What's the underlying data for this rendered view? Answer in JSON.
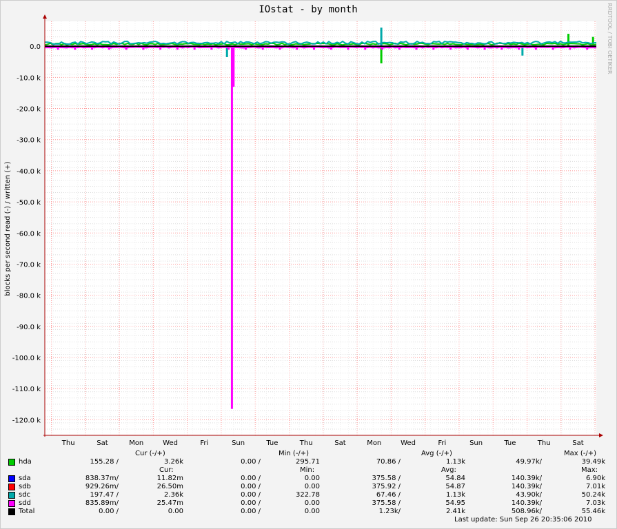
{
  "chart_data": {
    "type": "line",
    "title": "IOstat - by month",
    "ylabel": "blocks per second read (-) / written (+)",
    "watermark": "RRDTOOL / TOBI OETIKER",
    "ylim": [
      -125000,
      8000
    ],
    "yticks": [
      0,
      -10000,
      -20000,
      -30000,
      -40000,
      -50000,
      -60000,
      -70000,
      -80000,
      -90000,
      -100000,
      -110000,
      -120000
    ],
    "ytick_labels": [
      "0.0",
      "-10.0 k",
      "-20.0 k",
      "-30.0 k",
      "-40.0 k",
      "-50.0 k",
      "-60.0 k",
      "-70.0 k",
      "-80.0 k",
      "-90.0 k",
      "-100.0 k",
      "-110.0 k",
      "-120.0 k"
    ],
    "xtick_labels": [
      "Thu",
      "Sat",
      "Mon",
      "Wed",
      "Fri",
      "Sun",
      "Tue",
      "Thu",
      "Sat",
      "Mon",
      "Wed",
      "Fri",
      "Sun",
      "Tue",
      "Thu",
      "Sat"
    ],
    "grid": true,
    "colors": {
      "hda": "#00cc00",
      "sda": "#0000ff",
      "sdb": "#ff0000",
      "sdc": "#00aaaa",
      "sdd": "#ff00ff",
      "total": "#000000",
      "gridline": "#ff9999",
      "axis": "#aa0000",
      "background": "#ffffff",
      "canvas": "#f3f3f3"
    },
    "series": [
      {
        "name": "hda",
        "written_baseline": 700,
        "read_baseline": -70,
        "spikes": [
          {
            "day": 31.9,
            "value": 4000
          },
          {
            "day": 33.4,
            "value": 3000
          },
          {
            "day": 20.5,
            "value": -5500
          }
        ]
      },
      {
        "name": "sdc",
        "written_baseline": 1130,
        "read_baseline": -67,
        "spikes": [
          {
            "day": 20.5,
            "value": 6000
          },
          {
            "day": 29.1,
            "value": -3000
          },
          {
            "day": 11.1,
            "value": -3500
          }
        ]
      },
      {
        "name": "sdd",
        "written_baseline": 55,
        "read_baseline": -376,
        "spikes": [
          {
            "day": 11.4,
            "value": -116500
          },
          {
            "day": 11.5,
            "value": -13000
          }
        ]
      },
      {
        "name": "Total",
        "written_baseline": 0,
        "read_baseline": 0
      }
    ],
    "days_span": 33.6
  },
  "legend": {
    "col_headers": {
      "cur": "Cur (-/+)",
      "min": "Min (-/+)",
      "avg": "Avg (-/+)",
      "max": "Max (-/+)"
    },
    "sub_headers": {
      "cur": "Cur:",
      "min": "Min:",
      "avg": "Avg:",
      "max": "Max:"
    },
    "rows": [
      {
        "name": "hda",
        "color": "#00cc00",
        "cur_r": "155.28 /",
        "cur_w": "3.26k",
        "min_r": "0.00 /",
        "min_w": "295.71",
        "avg_r": "70.86 /",
        "avg_w": "1.13k",
        "max_r": "49.97k/",
        "max_w": "39.49k"
      },
      {
        "name": "sda",
        "color": "#0000ff",
        "cur_r": "838.37m/",
        "cur_w": "11.82m",
        "min_r": "0.00 /",
        "min_w": "0.00",
        "avg_r": "375.58 /",
        "avg_w": "54.84",
        "max_r": "140.39k/",
        "max_w": "6.90k"
      },
      {
        "name": "sdb",
        "color": "#ff0000",
        "cur_r": "929.26m/",
        "cur_w": "26.50m",
        "min_r": "0.00 /",
        "min_w": "0.00",
        "avg_r": "375.92 /",
        "avg_w": "54.87",
        "max_r": "140.39k/",
        "max_w": "7.01k"
      },
      {
        "name": "sdc",
        "color": "#00aaaa",
        "cur_r": "197.47 /",
        "cur_w": "2.36k",
        "min_r": "0.00 /",
        "min_w": "322.78",
        "avg_r": "67.46 /",
        "avg_w": "1.13k",
        "max_r": "43.90k/",
        "max_w": "50.24k"
      },
      {
        "name": "sdd",
        "color": "#ff00ff",
        "cur_r": "835.89m/",
        "cur_w": "25.47m",
        "min_r": "0.00 /",
        "min_w": "0.00",
        "avg_r": "375.58 /",
        "avg_w": "54.95",
        "max_r": "140.39k/",
        "max_w": "7.03k"
      },
      {
        "name": "Total",
        "color": "#000000",
        "cur_r": "0.00 /",
        "cur_w": "0.00",
        "min_r": "0.00 /",
        "min_w": "0.00",
        "avg_r": "1.23k/",
        "avg_w": "2.41k",
        "max_r": "508.96k/",
        "max_w": "55.46k"
      }
    ],
    "last_update": "Last update: Sun Sep 26 20:35:06 2010"
  }
}
